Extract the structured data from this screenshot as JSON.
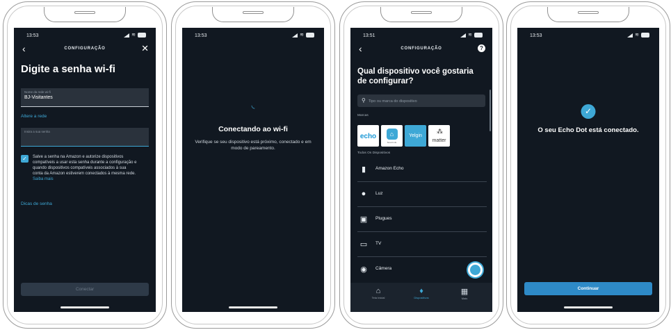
{
  "status": {
    "time_1": "13:53",
    "time_2": "13:53",
    "time_3": "13:51",
    "time_4": "13:53"
  },
  "screen1": {
    "nav_title": "CONFIGURAÇÃO",
    "heading": "Digite a senha wi-fi",
    "network_label": "Nome da rede wi-fi",
    "network_value": "BJ-Visitantes",
    "change_network_link": "Altere a rede",
    "password_placeholder": "Insira a sua senha",
    "checkbox_text": "Salve a senha na Amazon e autorize dispositivos compatíveis a usar esta senha durante a configuração e quando dispositivos compatíveis associados à sua conta da Amazon estiverem conectados à mesma rede.",
    "learn_more": "Saiba mais",
    "tips_link": "Dicas de senha",
    "connect_button": "Conectar"
  },
  "screen2": {
    "heading": "Conectando ao wi-fi",
    "subtext": "Verifique se seu dispositivo está próximo, conectado e em modo de pareamento."
  },
  "screen3": {
    "nav_title": "CONFIGURAÇÃO",
    "help": "?",
    "heading": "Qual dispositivo você gostaria de configurar?",
    "search_placeholder": "Tipo ou marca do dispositivo",
    "brands_label": "Marcas",
    "brands": [
      "echo",
      "Smart Life",
      "Yelgin",
      "matter"
    ],
    "all_devices_label": "Todos Os Dispositivos",
    "devices": [
      "Amazon Echo",
      "Luz",
      "Plugues",
      "TV",
      "Câmera"
    ],
    "tabs": [
      "Tela Inicial",
      "Dispositivos",
      "Mais"
    ]
  },
  "screen4": {
    "heading": "O seu Echo Dot está conectado.",
    "continue_button": "Continuar"
  }
}
